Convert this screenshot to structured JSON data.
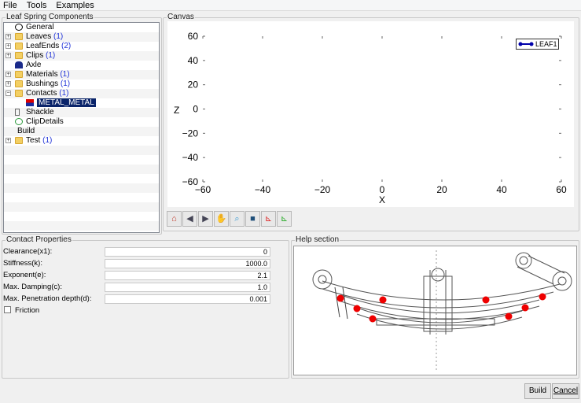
{
  "menu": [
    "File",
    "Tools",
    "Examples"
  ],
  "tree_panel": {
    "title": "Leaf Spring Components",
    "items": [
      {
        "label": "General",
        "count": "",
        "expander": "",
        "icon": "general-icon",
        "indent": 0
      },
      {
        "label": "Leaves",
        "count": "(1)",
        "expander": "+",
        "icon": "folder-icon",
        "indent": 0
      },
      {
        "label": "LeafEnds",
        "count": "(2)",
        "expander": "+",
        "icon": "folder-icon",
        "indent": 0
      },
      {
        "label": "Clips",
        "count": "(1)",
        "expander": "+",
        "icon": "folder-icon",
        "indent": 0
      },
      {
        "label": "Axle",
        "count": "",
        "expander": "",
        "icon": "axle-icon",
        "indent": 0
      },
      {
        "label": "Materials",
        "count": "(1)",
        "expander": "+",
        "icon": "folder-icon",
        "indent": 0
      },
      {
        "label": "Bushings",
        "count": "(1)",
        "expander": "+",
        "icon": "folder-icon",
        "indent": 0
      },
      {
        "label": "Contacts",
        "count": "(1)",
        "expander": "-",
        "icon": "folder-open-icon",
        "indent": 0
      },
      {
        "label": "METAL_METAL",
        "count": "",
        "expander": "",
        "icon": "contact-icon",
        "indent": 1,
        "selected": true
      },
      {
        "label": "Shackle",
        "count": "",
        "expander": "",
        "icon": "shackle-icon",
        "indent": 0
      },
      {
        "label": "ClipDetails",
        "count": "",
        "expander": "",
        "icon": "clipdetails-icon",
        "indent": 0
      },
      {
        "label": "Build",
        "count": "",
        "expander": "",
        "icon": "",
        "indent": -1
      },
      {
        "label": "Test",
        "count": "(1)",
        "expander": "+",
        "icon": "folder-icon",
        "indent": 0
      }
    ]
  },
  "canvas": {
    "title": "Canvas",
    "xlabel": "X",
    "ylabel": "Z",
    "xticks": [
      "−60",
      "−40",
      "−20",
      "0",
      "20",
      "40",
      "60"
    ],
    "yticks": [
      "60",
      "40",
      "20",
      "0",
      "−20",
      "−40",
      "−60"
    ],
    "legend": "LEAF1",
    "legend_color": "#0000aa"
  },
  "toolbar": [
    "home",
    "back",
    "forward",
    "pan",
    "zoom",
    "save",
    "xz-axis",
    "yx-axis"
  ],
  "contact": {
    "title": "Contact Properties",
    "fields": [
      {
        "label": "Clearance(x1):",
        "value": "0"
      },
      {
        "label": "Stiffness(k):",
        "value": "1000.0"
      },
      {
        "label": "Exponent(e):",
        "value": "2.1"
      },
      {
        "label": "Max. Damping(c):",
        "value": "1.0"
      },
      {
        "label": "Max. Penetration depth(d):",
        "value": "0.001"
      }
    ],
    "friction_label": "Friction"
  },
  "help": {
    "title": "Help section"
  },
  "buttons": {
    "build": "Build",
    "cancel": "Cancel"
  }
}
